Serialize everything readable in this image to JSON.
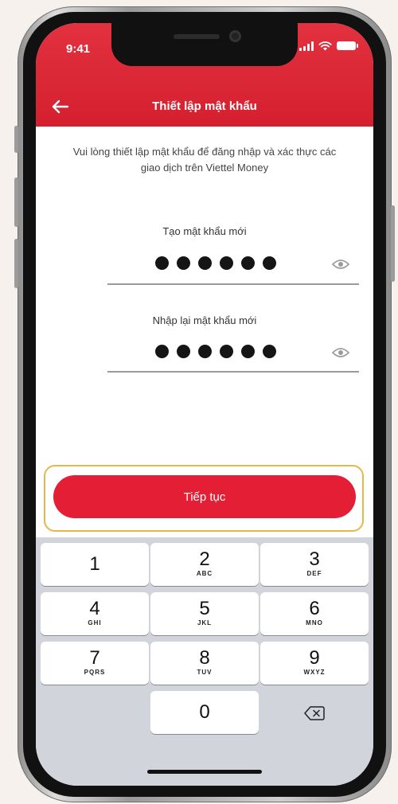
{
  "status_bar": {
    "time": "9:41"
  },
  "header": {
    "title": "Thiết lập mật khẩu"
  },
  "icons": {
    "back": "arrow-left-icon",
    "eye": "eye-icon",
    "backspace": "backspace-icon",
    "signal": "signal-icon",
    "wifi": "wifi-icon",
    "battery": "battery-icon"
  },
  "instruction": "Vui lòng thiết lập mật khẩu để đăng nhập và xác thực các giao dịch trên Viettel Money",
  "fields": [
    {
      "label": "Tạo mật khẩu mới",
      "value_length": 6
    },
    {
      "label": "Nhập lại mật khẩu mới",
      "value_length": 6
    }
  ],
  "continue_button": {
    "label": "Tiếp tục"
  },
  "keypad": [
    {
      "num": "1",
      "letters": ""
    },
    {
      "num": "2",
      "letters": "ABC"
    },
    {
      "num": "3",
      "letters": "DEF"
    },
    {
      "num": "4",
      "letters": "GHI"
    },
    {
      "num": "5",
      "letters": "JKL"
    },
    {
      "num": "6",
      "letters": "MNO"
    },
    {
      "num": "7",
      "letters": "PQRS"
    },
    {
      "num": "8",
      "letters": "TUV"
    },
    {
      "num": "9",
      "letters": "WXYZ"
    },
    {
      "num": "0",
      "letters": ""
    }
  ],
  "colors": {
    "brand_red": "#e41f35",
    "header_red": "#d51f2f",
    "highlight_border": "#e9b64b",
    "keyboard_bg": "#d1d4db"
  }
}
